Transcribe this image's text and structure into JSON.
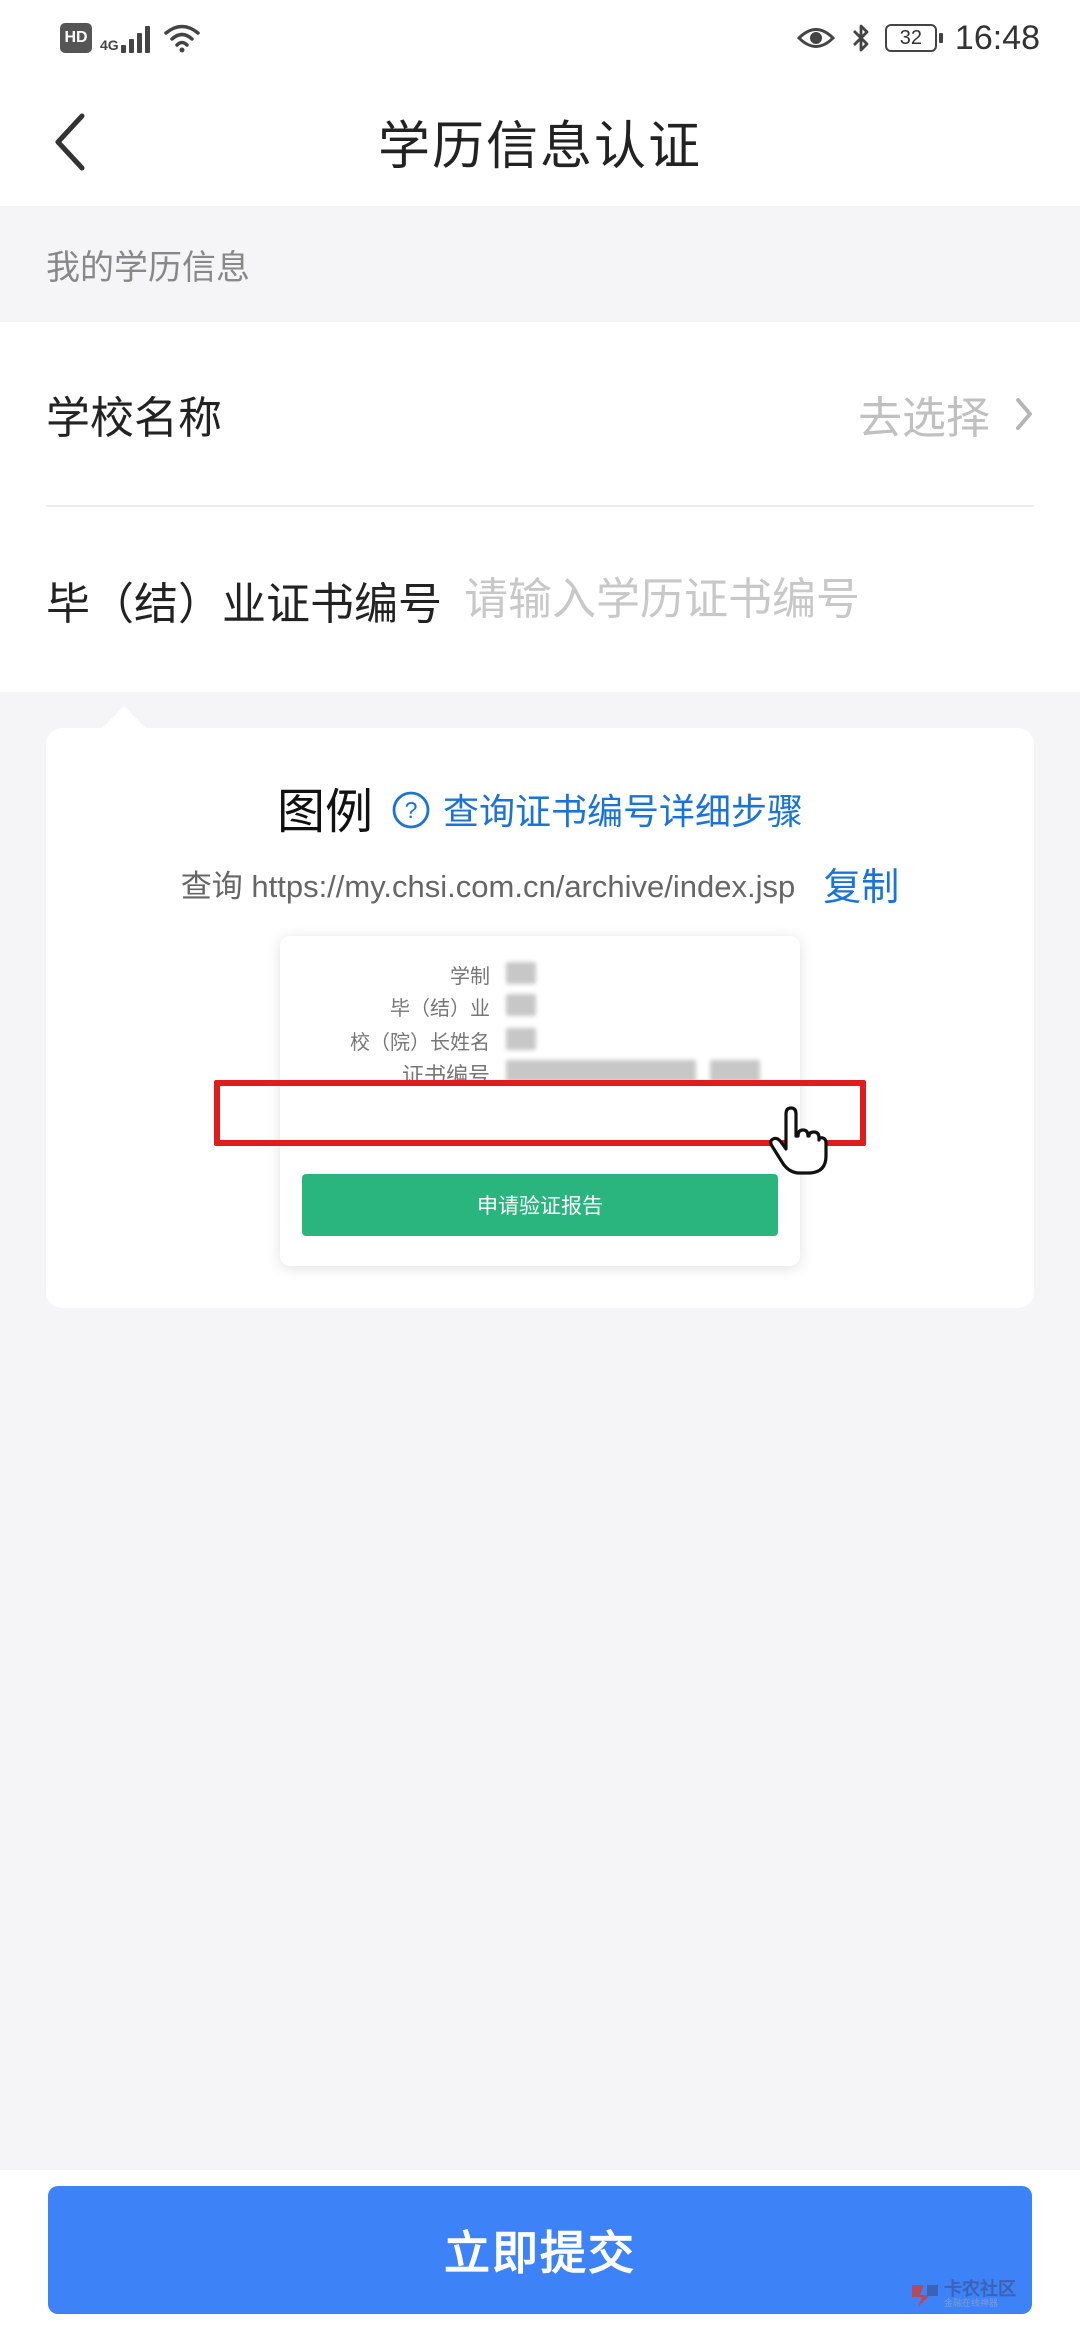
{
  "status_bar": {
    "hd": "HD",
    "network": "4G",
    "battery": "32",
    "time": "16:48"
  },
  "header": {
    "title": "学历信息认证",
    "back_icon": "chevron-left-icon"
  },
  "section": {
    "label": "我的学历信息"
  },
  "form": {
    "school_label": "学校名称",
    "school_value": "去选择",
    "cert_label": "毕（结）业证书编号",
    "cert_placeholder": "请输入学历证书编号",
    "cert_value": ""
  },
  "example": {
    "title": "图例",
    "link_text": "查询证书编号详细步骤",
    "url_text": "查询 https://my.chsi.com.cn/archive/index.jsp",
    "copy_label": "复制",
    "illustration": {
      "rows": [
        "学制",
        "毕（结）业",
        "校（院）长姓名",
        "证书编号"
      ],
      "button_label": "申请验证报告"
    }
  },
  "footer": {
    "submit_label": "立即提交",
    "watermark": "卡农社区",
    "watermark_sub": "金融在线神器"
  },
  "colors": {
    "accent": "#3d82f7",
    "link": "#1a73d9",
    "highlight": "#e01c1c",
    "green_button": "#2bb57e",
    "background": "#f5f5f7"
  }
}
